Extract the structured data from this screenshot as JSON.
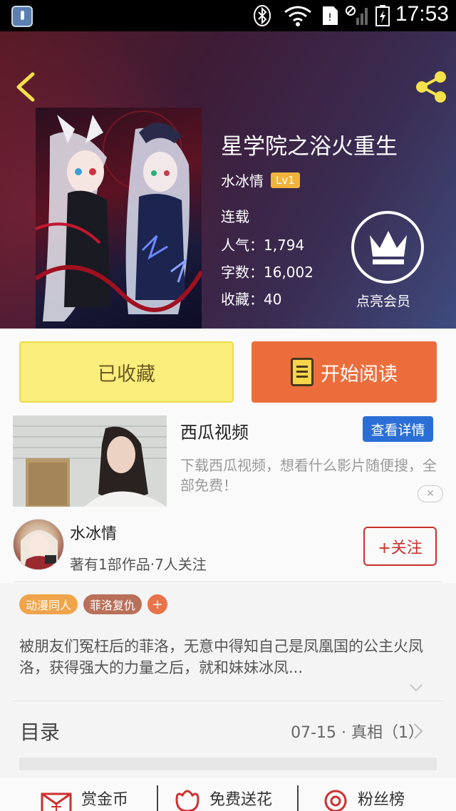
{
  "status_bar": {
    "time": "17:53"
  },
  "book": {
    "title": "星学院之浴火重生",
    "author": "水冰情",
    "author_level": "Lv1",
    "status": "连载",
    "popularity": "人气：1,794",
    "word_count": "字数：16,002",
    "favorites": "收藏：40",
    "vip_label": "点亮会员"
  },
  "actions": {
    "favorited_label": "已收藏",
    "read_label": "开始阅读"
  },
  "ad": {
    "title": "西瓜视频",
    "button": "查看详情",
    "description": "下载西瓜视频，想看什么影片随便搜，全部免费！"
  },
  "author_card": {
    "name": "水冰情",
    "meta": "著有1部作品·7人关注",
    "follow_label": "+关注"
  },
  "tags": [
    "动漫同人",
    "菲洛复仇"
  ],
  "tag_add": "+",
  "intro": "被朋友们冤枉后的菲洛，无意中得知自己是凤凰国的公主火凤洛，获得强大的力量之后，就和妹妹冰凤...",
  "toc": {
    "label": "目录",
    "latest": "07-15 · 真相（1）"
  },
  "bottom_bar": {
    "reward": "赏金币",
    "flower": "免费送花",
    "fans": "粉丝榜"
  },
  "colors": {
    "accent_orange": "#ec6d3c",
    "fav_yellow": "#fbee7c",
    "follow_red": "#c9302c",
    "ad_blue": "#2b6fd6"
  }
}
